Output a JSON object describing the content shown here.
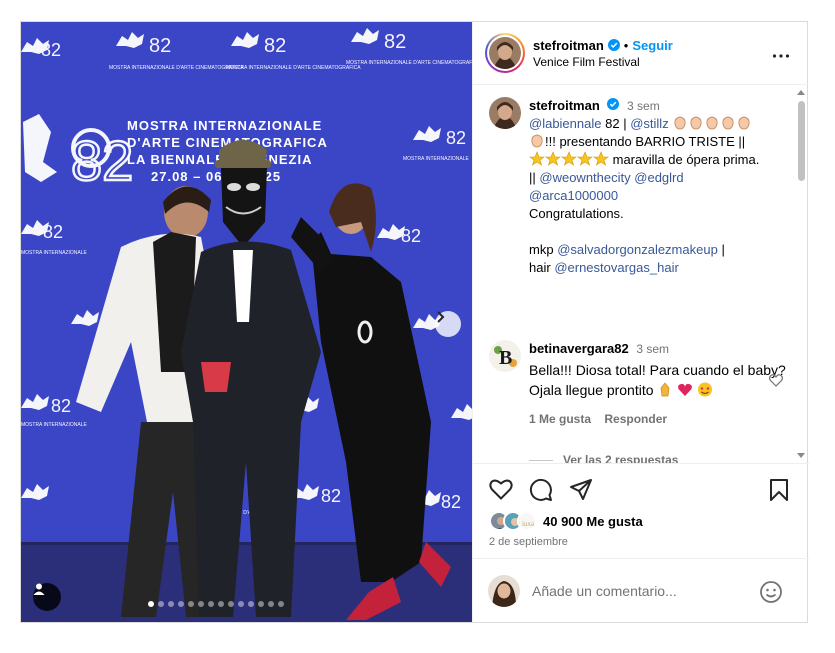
{
  "post": {
    "author": "stefroitman",
    "follow_label": "Seguir",
    "separator": "•",
    "location": "Venice Film Festival",
    "backdrop": {
      "logo_number": "82",
      "line1": "MOSTRA INTERNAZIONALE",
      "line2": "D'ARTE CINEMATOGRAFICA",
      "line3": "LA BIENNALE DI VENEZIA",
      "dates": "27.08 – 06.09 2025"
    },
    "carousel": {
      "count": 14,
      "active": 0
    }
  },
  "caption": {
    "user": "stefroitman",
    "time": "3 sem",
    "mention_biennale": "@labiennale",
    "number": "82",
    "pipe": "|",
    "mention_stillz": "@stillz",
    "presenting": "!!! presentando BARRIO TRISTE ||",
    "masterpiece": "maravilla de ópera prima.",
    "pipes": "||",
    "mention_weownthecity": "@weownthecity",
    "mention_edglrd": "@edglrd",
    "mention_arca": "@arca1000000",
    "congrats": "Congratulations.",
    "mkp_label": "mkp",
    "mention_mkp": "@salvadorgonzalezmakeup",
    "hair_label": "hair",
    "mention_hair": "@ernestovargas_hair"
  },
  "comment": {
    "user": "betinavergara82",
    "time": "3 sem",
    "text": "Bella!!! Diosa total! Para cuando el baby? Ojala llegue prontito",
    "likes": "1 Me gusta",
    "reply": "Responder",
    "view_replies": "Ver las 2 respuestas"
  },
  "footer": {
    "likes": "40 900 Me gusta",
    "date": "2 de septiembre",
    "add_comment_placeholder": "Añade un comentario..."
  },
  "colors": {
    "accent": "#0095f6",
    "mention": "#385898",
    "backdrop": "#3a45c8",
    "heart": "#e0245e"
  },
  "icons": [
    "verified-icon",
    "more-icon",
    "heart-icon",
    "comment-icon",
    "share-icon",
    "bookmark-icon",
    "chevron-right-icon",
    "user-tag-icon",
    "emoji-icon"
  ]
}
